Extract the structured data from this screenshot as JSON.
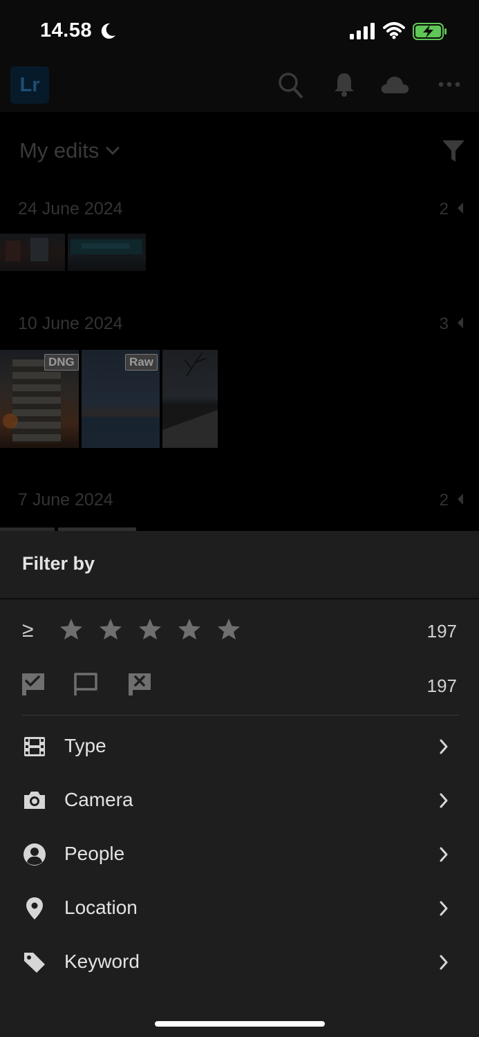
{
  "status": {
    "time": "14.58"
  },
  "app": {
    "logo": "Lr"
  },
  "album": {
    "title": "My edits"
  },
  "groups": [
    {
      "date": "24 June 2024",
      "count": "2"
    },
    {
      "date": "10 June 2024",
      "count": "3"
    },
    {
      "date": "7 June 2024",
      "count": "2"
    }
  ],
  "badges": {
    "dng": "DNG",
    "raw": "Raw"
  },
  "filter": {
    "title": "Filter by",
    "rating_operator": "≥",
    "rating_count": "197",
    "flag_count": "197",
    "items": [
      {
        "label": "Type",
        "icon": "film-icon"
      },
      {
        "label": "Camera",
        "icon": "camera-icon"
      },
      {
        "label": "People",
        "icon": "person-icon"
      },
      {
        "label": "Location",
        "icon": "location-pin-icon"
      },
      {
        "label": "Keyword",
        "icon": "tag-icon"
      }
    ]
  },
  "colors": {
    "sheet_bg": "#1e1e1e",
    "dim_bg": "#000000",
    "logo_text": "#1d4f72"
  }
}
